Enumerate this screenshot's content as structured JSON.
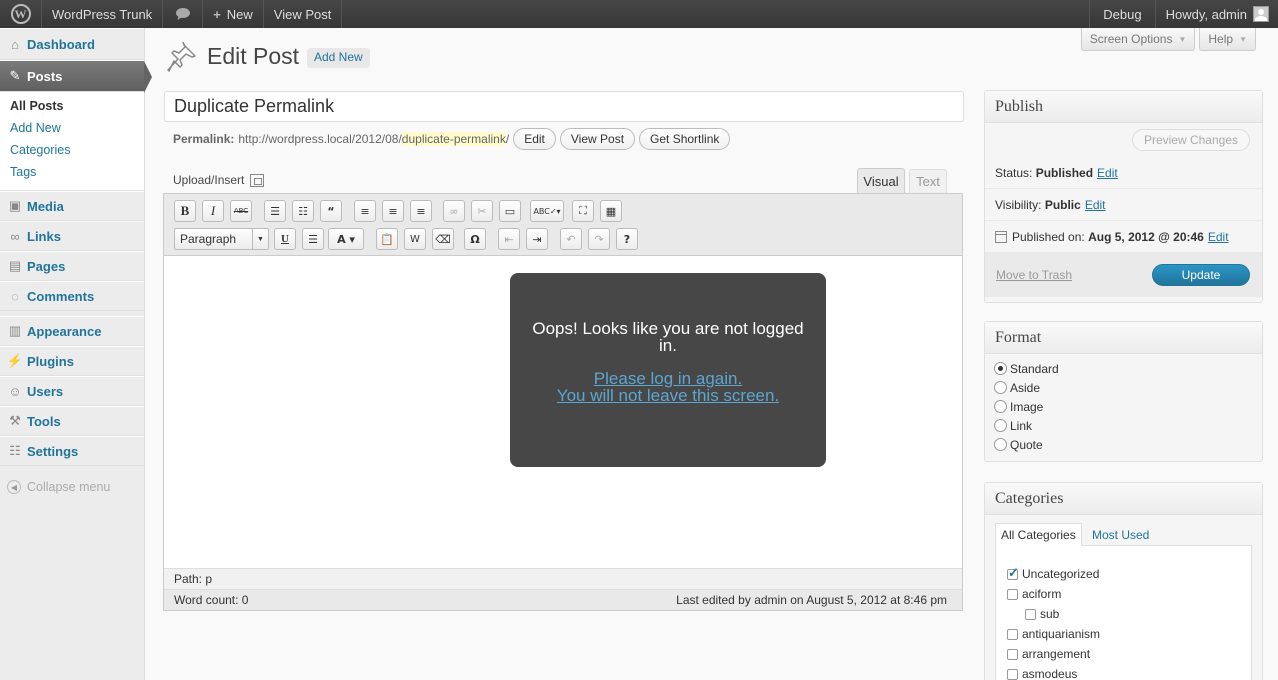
{
  "adminbar": {
    "logo": "W",
    "site_name": "WordPress Trunk",
    "comments_icon": "comment-bubble-icon",
    "new_label": "New",
    "view_post": "View Post",
    "debug": "Debug",
    "howdy": "Howdy, admin"
  },
  "sidebar": {
    "dashboard": "Dashboard",
    "posts": "Posts",
    "posts_sub": [
      "All Posts",
      "Add New",
      "Categories",
      "Tags"
    ],
    "media": "Media",
    "links": "Links",
    "pages": "Pages",
    "comments": "Comments",
    "appearance": "Appearance",
    "plugins": "Plugins",
    "users": "Users",
    "tools": "Tools",
    "settings": "Settings",
    "collapse": "Collapse menu"
  },
  "screen_meta": {
    "screen_options": "Screen Options",
    "help": "Help"
  },
  "header": {
    "title": "Edit Post",
    "add_new": "Add New"
  },
  "post": {
    "title": "Duplicate Permalink",
    "permalink_label": "Permalink:",
    "permalink_base": "http://wordpress.local/2012/08/",
    "permalink_slug": "duplicate-permalink",
    "permalink_end": "/",
    "edit_btn": "Edit",
    "view_btn": "View Post",
    "shortlink_btn": "Get Shortlink"
  },
  "editor": {
    "upload_insert": "Upload/Insert",
    "tab_visual": "Visual",
    "tab_text": "Text",
    "format_select": "Paragraph",
    "path": "Path: p",
    "word_count": "Word count: 0",
    "last_edited": "Last edited by admin on August 5, 2012 at 8:46 pm"
  },
  "overlay": {
    "message": "Oops! Looks like you are not logged in.",
    "link_line1": "Please log in again.",
    "link_line2": "You will not leave this screen."
  },
  "publish": {
    "title": "Publish",
    "preview": "Preview Changes",
    "status_label": "Status:",
    "status_value": "Published",
    "visibility_label": "Visibility:",
    "visibility_value": "Public",
    "published_label": "Published on:",
    "published_value": "Aug 5, 2012 @ 20:46",
    "edit": "Edit",
    "trash": "Move to Trash",
    "update": "Update"
  },
  "format": {
    "title": "Format",
    "options": [
      "Standard",
      "Aside",
      "Image",
      "Link",
      "Quote"
    ],
    "selected": "Standard"
  },
  "categories": {
    "title": "Categories",
    "tab_all": "All Categories",
    "tab_used": "Most Used",
    "items": [
      "Uncategorized",
      "aciform",
      "sub",
      "antiquarianism",
      "arrangement",
      "asmodeus"
    ]
  },
  "colors": {
    "link": "#21759b",
    "adminbar": "#464646",
    "overlay": "#474747",
    "update": "#21759b"
  }
}
